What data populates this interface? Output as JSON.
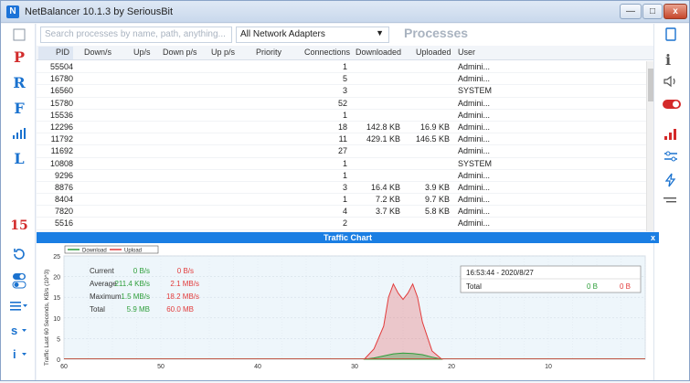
{
  "window": {
    "title": "NetBalancer 10.1.3 by SeriousBit",
    "minimize_label": "—",
    "restore_label": "□",
    "close_label": "x"
  },
  "toolbar": {
    "search_placeholder": "Search processes by name, path, anything...",
    "adapter_value": "All Network Adapters",
    "section_title": "Processes"
  },
  "left_sidebar": {
    "items": [
      "P",
      "R",
      "F",
      "L"
    ],
    "counter": "15"
  },
  "table": {
    "columns": [
      "PID",
      "Down/s",
      "Up/s",
      "Down p/s",
      "Up p/s",
      "Priority",
      "Connections",
      "Downloaded",
      "Uploaded",
      "User"
    ],
    "rows": [
      [
        "55504",
        "",
        "",
        "",
        "",
        "",
        "1",
        "",
        "",
        "Admini..."
      ],
      [
        "16780",
        "",
        "",
        "",
        "",
        "",
        "5",
        "",
        "",
        "Admini..."
      ],
      [
        "16560",
        "",
        "",
        "",
        "",
        "",
        "3",
        "",
        "",
        "SYSTEM"
      ],
      [
        "15780",
        "",
        "",
        "",
        "",
        "",
        "52",
        "",
        "",
        "Admini..."
      ],
      [
        "15536",
        "",
        "",
        "",
        "",
        "",
        "1",
        "",
        "",
        "Admini..."
      ],
      [
        "12296",
        "",
        "",
        "",
        "",
        "",
        "18",
        "142.8 KB",
        "16.9 KB",
        "Admini..."
      ],
      [
        "11792",
        "",
        "",
        "",
        "",
        "",
        "11",
        "429.1 KB",
        "146.5 KB",
        "Admini..."
      ],
      [
        "11692",
        "",
        "",
        "",
        "",
        "",
        "27",
        "",
        "",
        "Admini..."
      ],
      [
        "10808",
        "",
        "",
        "",
        "",
        "",
        "1",
        "",
        "",
        "SYSTEM"
      ],
      [
        "9296",
        "",
        "",
        "",
        "",
        "",
        "1",
        "",
        "",
        "Admini..."
      ],
      [
        "8876",
        "",
        "",
        "",
        "",
        "",
        "3",
        "16.4 KB",
        "3.9 KB",
        "Admini..."
      ],
      [
        "8404",
        "",
        "",
        "",
        "",
        "",
        "1",
        "7.2 KB",
        "9.7 KB",
        "Admini..."
      ],
      [
        "7820",
        "",
        "",
        "",
        "",
        "",
        "4",
        "3.7 KB",
        "5.8 KB",
        "Admini..."
      ],
      [
        "5516",
        "",
        "",
        "",
        "",
        "",
        "2",
        "",
        "",
        "Admini..."
      ]
    ]
  },
  "traffic_chart": {
    "header": "Traffic Chart",
    "close_label": "x",
    "legend": [
      "Download",
      "Upload"
    ],
    "ylabel": "Traffic Last 60 Seconds, KB/s (10^3)",
    "y_ticks": [
      "0",
      "5",
      "10",
      "15",
      "20",
      "25"
    ],
    "x_ticks": [
      "60",
      "50",
      "40",
      "30",
      "20",
      "10"
    ],
    "stats": {
      "labels": [
        "Current",
        "Average",
        "Maximum",
        "Total"
      ],
      "download": [
        "0 B/s",
        "211.4 KB/s",
        "1.5 MB/s",
        "5.9 MB"
      ],
      "upload": [
        "0 B/s",
        "2.1 MB/s",
        "18.2 MB/s",
        "60.0 MB"
      ]
    },
    "info": {
      "timestamp": "16:53:44 - 2020/8/27",
      "total_label": "Total",
      "download": "0 B",
      "upload": "0 B"
    }
  },
  "colors": {
    "accent": "#1a7ee3",
    "download": "#2e9e3a",
    "upload": "#e23b3b"
  },
  "chart_data": {
    "type": "area",
    "ylabel": "Traffic Last 60 Seconds, KB/s (10^3)",
    "xlim": [
      60,
      0
    ],
    "ylim": [
      0,
      25
    ],
    "grid": true,
    "legend_position": "top-left",
    "x_ticks": [
      60,
      50,
      40,
      30,
      20,
      10
    ],
    "y_ticks": [
      0,
      5,
      10,
      15,
      20,
      25
    ],
    "series": [
      {
        "name": "Download",
        "x": [
          29,
          28,
          27,
          26,
          25,
          24,
          23,
          22,
          21
        ],
        "values": [
          0,
          0.3,
          0.8,
          1.3,
          1.5,
          1.4,
          1.1,
          0.5,
          0
        ]
      },
      {
        "name": "Upload",
        "x": [
          29,
          28,
          27,
          26.5,
          26,
          25.5,
          25,
          24.5,
          24,
          23.5,
          23,
          22,
          21
        ],
        "values": [
          0,
          2.5,
          8,
          15,
          18.2,
          16,
          14.5,
          16,
          18.2,
          15,
          9,
          2,
          0
        ]
      }
    ]
  }
}
